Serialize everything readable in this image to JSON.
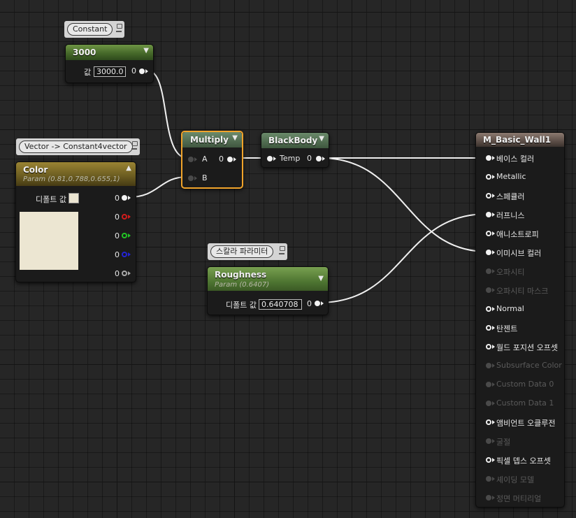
{
  "comments": {
    "constant": "Constant",
    "vector": "Vector -> Constant4vector",
    "scalar": "스칼라 파라미터"
  },
  "node_constant": {
    "title": "3000",
    "label": "값",
    "value": "3000.0",
    "out": "0"
  },
  "node_color": {
    "title": "Color",
    "subtitle": "Param (0.81,0.788,0.655,1)",
    "default_label": "디폴트 값",
    "swatch": "#ece6d2",
    "outs": [
      "0",
      "0",
      "0",
      "0",
      "0"
    ]
  },
  "node_multiply": {
    "title": "Multiply",
    "in_a": "A",
    "in_b": "B",
    "out": "0"
  },
  "node_blackbody": {
    "title": "BlackBody",
    "in": "Temp",
    "out": "0"
  },
  "node_roughness": {
    "title": "Roughness",
    "subtitle": "Param (0.6407)",
    "default_label": "디폴트 값",
    "value": "0.640708",
    "out": "0"
  },
  "node_material": {
    "title": "M_Basic_Wall1",
    "pins": [
      {
        "label": "베이스 컬러",
        "state": "connected"
      },
      {
        "label": "Metallic",
        "state": "active"
      },
      {
        "label": "스페큘러",
        "state": "active"
      },
      {
        "label": "러프니스",
        "state": "connected"
      },
      {
        "label": "애니소트로피",
        "state": "active"
      },
      {
        "label": "이미시브 컬러",
        "state": "connected"
      },
      {
        "label": "오파시티",
        "state": "disabled"
      },
      {
        "label": "오파시티 마스크",
        "state": "disabled"
      },
      {
        "label": "Normal",
        "state": "active"
      },
      {
        "label": "탄젠트",
        "state": "active"
      },
      {
        "label": "월드 포지션 오프셋",
        "state": "active"
      },
      {
        "label": "Subsurface Color",
        "state": "disabled"
      },
      {
        "label": "Custom Data 0",
        "state": "disabled"
      },
      {
        "label": "Custom Data 1",
        "state": "disabled"
      },
      {
        "label": "앰비언트 오클루전",
        "state": "active"
      },
      {
        "label": "굴절",
        "state": "disabled"
      },
      {
        "label": "픽셀 뎁스 오프셋",
        "state": "active"
      },
      {
        "label": "셰이딩 모델",
        "state": "disabled"
      },
      {
        "label": "정면 머티리얼",
        "state": "disabled"
      }
    ]
  },
  "colors": {
    "selection": "#f0a32a",
    "wire": "#f0f0f0",
    "pin_red": "#d01c1c",
    "pin_green": "#22c424",
    "pin_blue": "#2424d4"
  }
}
